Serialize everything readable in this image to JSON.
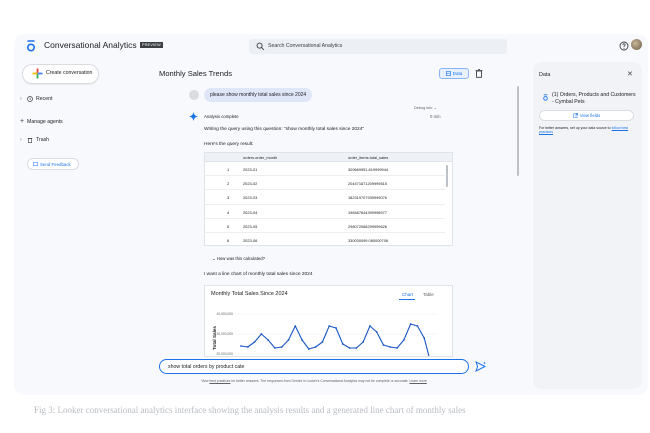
{
  "header": {
    "app_title": "Conversational Analytics",
    "preview_badge": "PREVIEW",
    "search_placeholder": "Search Conversational Analytics"
  },
  "sidebar": {
    "create_label": "Create conversation",
    "recent_label": "Recent",
    "manage_agents_label": "Manage agents",
    "trash_label": "Trash",
    "feedback_label": "Send Feedback"
  },
  "conversation": {
    "title": "Monthly Sales Trends",
    "data_button_label": "Data",
    "user_message": "please show monthly total sales since 2024",
    "debug_label": "Debug info",
    "analysis_status": "Analysis complete",
    "analysis_time": "0 min",
    "query_intro": "Writing the query using this question: \"show monthly total sales since 2024\"",
    "result_intro": "Here's the query result:",
    "table": {
      "columns": [
        "orders.order_month",
        "order_items.total_sales"
      ],
      "rows": [
        [
          "1",
          "2023-01",
          "309669951.819999944"
        ],
        [
          "2",
          "2023-02",
          "204471871209999815"
        ],
        [
          "3",
          "2023-03",
          "182319707939999076"
        ],
        [
          "4",
          "2023-04",
          "198487644399998977"
        ],
        [
          "5",
          "2023-05",
          "298072068299999626"
        ],
        [
          "6",
          "2023-06",
          "330030099.080000706"
        ]
      ]
    },
    "how_calculated": "How was this calculated?",
    "chart_intro": "I want a line chart of monthly total sales since 2024",
    "chart_tab_chart": "Chart",
    "chart_tab_table": "Table"
  },
  "chart_data": {
    "type": "line",
    "title": "Monthly Total Sales Since 2024",
    "xlabel": "",
    "ylabel": "Total Sales",
    "y_ticks": [
      "40,000,000",
      "30,000,000",
      "20,000,000"
    ],
    "ylim": [
      15000000,
      42000000
    ],
    "values": [
      24000000,
      23500000,
      26000000,
      30000000,
      27000000,
      23000000,
      23500000,
      27000000,
      34000000,
      27000000,
      22500000,
      23500000,
      26000000,
      34000000,
      33000000,
      25000000,
      23000000,
      23000000,
      26000000,
      34000000,
      31000000,
      24500000,
      23500000,
      23000000,
      27000000,
      35000000,
      34000000,
      28000000,
      15000000
    ],
    "color": "#1a56c4"
  },
  "prompt": {
    "value": "show total orders by product cate"
  },
  "disclaimer": {
    "pre": "View ",
    "link1": "best practices",
    "mid": " for better answers. The responses from Gemini in Looker's Conversational Analytics may not be complete or accurate. ",
    "link2": "Learn more"
  },
  "data_panel": {
    "title": "Data",
    "source_label": "(1) Orders, Products and Customers - Cymbal Pets",
    "view_fields_label": "View fields",
    "note_pre": "For better answers, set up your data source to ",
    "note_link": "follow best practices"
  },
  "caption_text": "Fig 3: Looker conversational analytics interface showing the analysis results and a generated line chart of monthly sales"
}
